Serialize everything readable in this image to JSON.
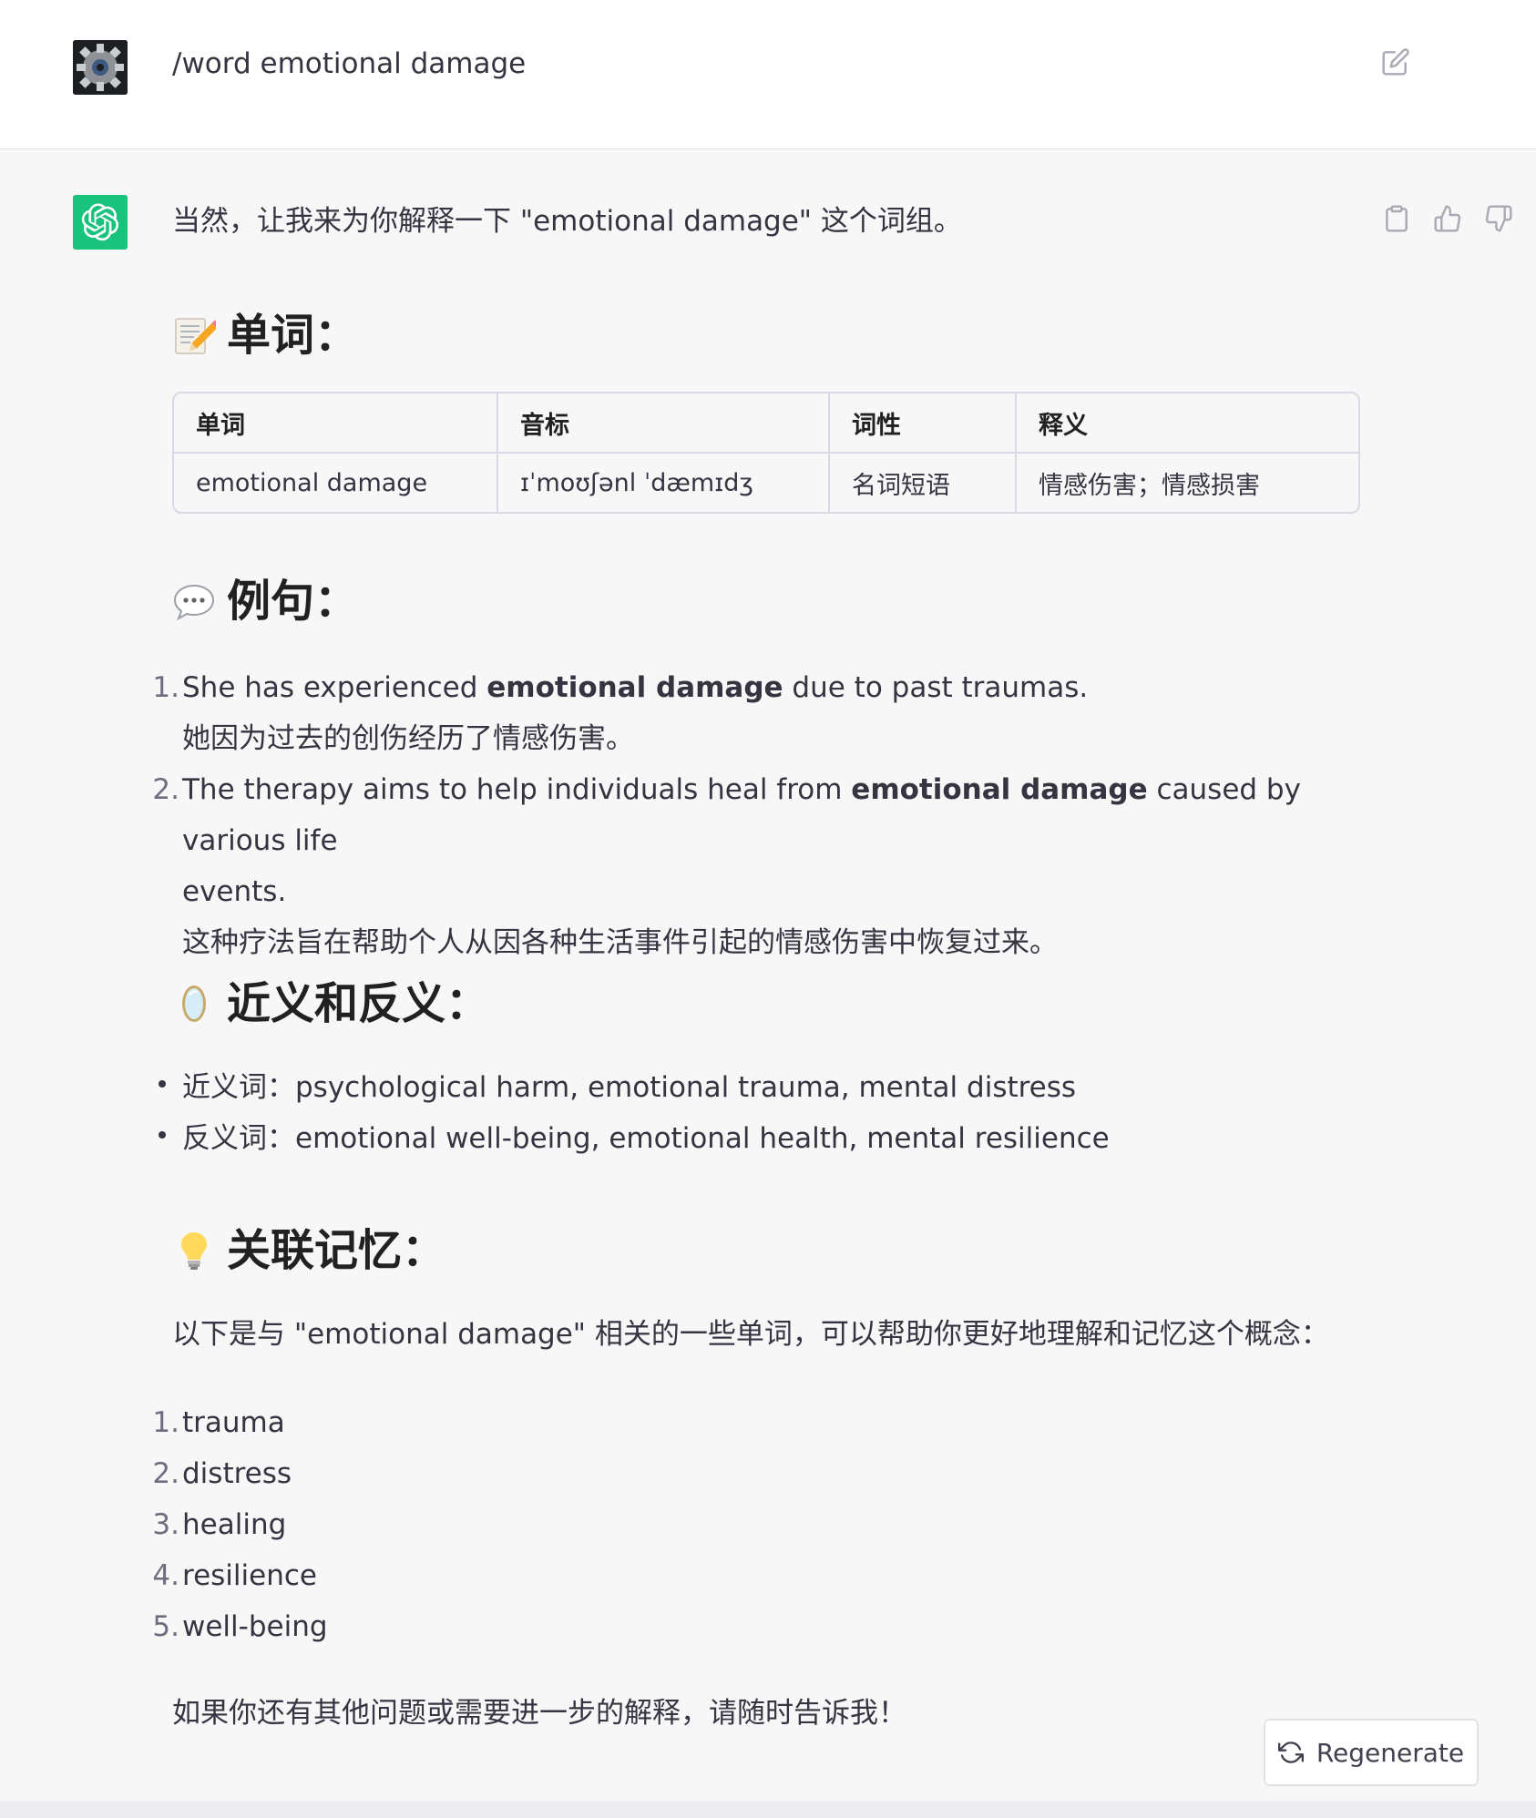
{
  "user_message": {
    "text": "/word emotional damage"
  },
  "assistant": {
    "intro": "当然，让我来为你解释一下 \"emotional damage\" 这个词组。",
    "word_section": {
      "title": "单词：",
      "emoji": "memo-icon",
      "table": {
        "headers": [
          "单词",
          "音标",
          "词性",
          "释义"
        ],
        "rows": [
          [
            "emotional damage",
            "ɪˈmoʊʃənl ˈdæmɪdʒ",
            "名词短语",
            "情感伤害；情感损害"
          ]
        ]
      }
    },
    "examples_section": {
      "title": "例句：",
      "emoji": "speech-bubble-icon",
      "items": [
        {
          "number": "1.",
          "en_before": "She has experienced ",
          "en_bold": "emotional damage",
          "en_after": " due to past traumas.",
          "zh": "她因为过去的创伤经历了情感伤害。"
        },
        {
          "number": "2.",
          "en_before": "The therapy aims to help individuals heal from ",
          "en_bold": "emotional damage",
          "en_after": " caused by various life",
          "en_wrap": "events.",
          "zh": "这种疗法旨在帮助个人从因各种生活事件引起的情感伤害中恢复过来。"
        }
      ]
    },
    "synonyms_section": {
      "title": "近义和反义：",
      "emoji": "mirror-icon",
      "items": [
        {
          "label": "近义词：",
          "value": "psychological harm, emotional trauma, mental distress"
        },
        {
          "label": "反义词：",
          "value": "emotional well-being, emotional health, mental resilience"
        }
      ]
    },
    "memory_section": {
      "title": "关联记忆：",
      "emoji": "light-bulb-icon",
      "intro": "以下是与 \"emotional damage\" 相关的一些单词，可以帮助你更好地理解和记忆这个概念：",
      "items": [
        {
          "number": "1.",
          "word": "trauma"
        },
        {
          "number": "2.",
          "word": "distress"
        },
        {
          "number": "3.",
          "word": "healing"
        },
        {
          "number": "4.",
          "word": "resilience"
        },
        {
          "number": "5.",
          "word": "well-being"
        }
      ]
    },
    "closing": "如果你还有其他问题或需要进一步的解释，请随时告诉我！"
  },
  "regenerate_label": "Regenerate",
  "colors": {
    "gpt_avatar_bg": "#19c37d",
    "page_bg": "#f7f7f8",
    "user_bg": "#ffffff",
    "text": "#343541"
  }
}
